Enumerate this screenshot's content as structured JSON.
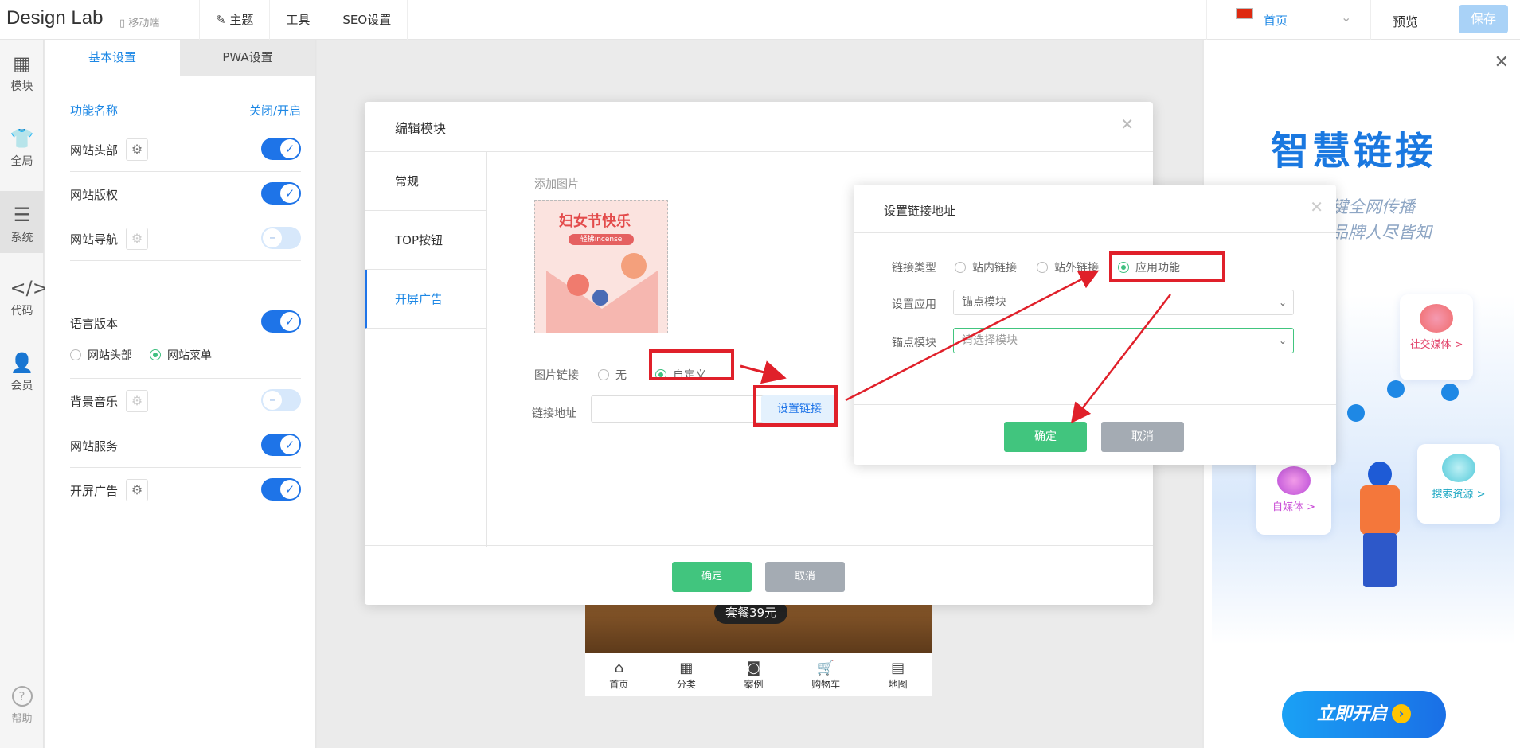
{
  "header": {
    "logo": "Design Lab",
    "mobile": "移动端",
    "nav": [
      "主题",
      "工具",
      "SEO设置"
    ],
    "page_select": "首页",
    "preview": "预览",
    "save": "保存"
  },
  "iconbar": {
    "items": [
      {
        "label": "模块",
        "icon": "grid-icon"
      },
      {
        "label": "全局",
        "icon": "shirt-icon"
      },
      {
        "label": "系统",
        "icon": "document-icon"
      },
      {
        "label": "代码",
        "icon": "code-icon"
      },
      {
        "label": "会员",
        "icon": "user-icon"
      }
    ],
    "active": "系统",
    "help": "帮助"
  },
  "settings": {
    "tabs": [
      "基本设置",
      "PWA设置"
    ],
    "header": {
      "name": "功能名称",
      "toggle": "关闭/开启"
    },
    "rows": [
      {
        "name": "网站头部",
        "gear": true,
        "on": true
      },
      {
        "name": "网站版权",
        "gear": false,
        "on": true
      },
      {
        "name": "网站导航",
        "gear": true,
        "on": false
      },
      {
        "name": "语言版本",
        "gear": false,
        "on": true
      },
      {
        "name": "背景音乐",
        "gear": true,
        "on": false
      },
      {
        "name": "网站服务",
        "gear": false,
        "on": true
      },
      {
        "name": "开屏广告",
        "gear": true,
        "on": true
      }
    ],
    "lang_options": [
      "网站头部",
      "网站菜单"
    ],
    "lang_selected": "网站菜单"
  },
  "phone": {
    "price_tag": "套餐39元",
    "nav": [
      "首页",
      "分类",
      "案例",
      "购物车",
      "地图"
    ]
  },
  "edit_modal": {
    "title": "编辑模块",
    "side": [
      "常规",
      "TOP按钮",
      "开屏广告"
    ],
    "active_side": "开屏广告",
    "add_image": "添加图片",
    "ad_title": "妇女节快乐",
    "ad_sub": "轻拂incense",
    "image_link_label": "图片链接",
    "link_options": [
      "无",
      "自定义"
    ],
    "link_selected": "自定义",
    "link_addr_label": "链接地址",
    "set_link": "设置链接",
    "ok": "确定",
    "cancel": "取消"
  },
  "link_dialog": {
    "title": "设置链接地址",
    "type_label": "链接类型",
    "type_options": [
      "站内链接",
      "站外链接",
      "应用功能"
    ],
    "type_selected": "应用功能",
    "app_label": "设置应用",
    "app_value": "锚点模块",
    "anchor_label": "锚点模块",
    "anchor_placeholder": "请选择模块",
    "ok": "确定",
    "cancel": "取消"
  },
  "promo": {
    "title": "智慧链接",
    "subtitle1": "键全网传播",
    "subtitle2": "品牌人尽皆知",
    "cards": [
      "社交媒体 >",
      "自媒体 >",
      "搜索资源 >"
    ],
    "cta": "立即开启"
  },
  "colors": {
    "accent": "#1e74e8",
    "ok_green": "#41c57e",
    "annotation_red": "#e0202a"
  }
}
